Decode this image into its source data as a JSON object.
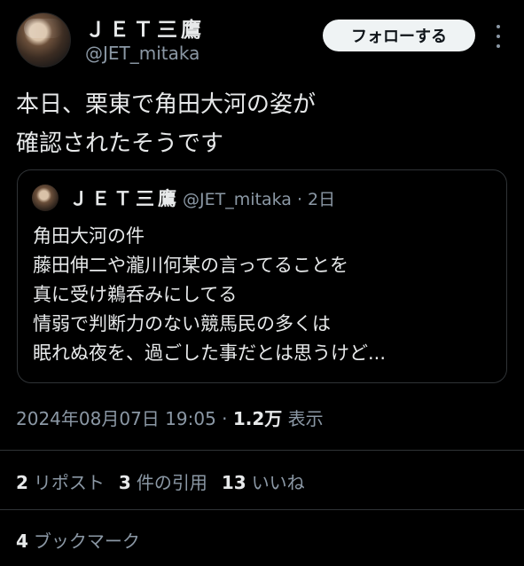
{
  "author": {
    "display_name": "ＪＥＴ三鷹",
    "handle": "@JET_mitaka"
  },
  "follow_button": "フォローする",
  "tweet": {
    "lines": [
      "本日、栗東で角田大河の姿が",
      "確認されたそうです"
    ]
  },
  "quoted": {
    "display_name": "ＪＥＴ三鷹",
    "meta": "@JET_mitaka · 2日",
    "lines": [
      "角田大河の件",
      "藤田伸二や瀧川何某の言ってることを",
      "真に受け鵜呑みにしてる",
      "情弱で判断力のない競馬民の多くは",
      "眠れぬ夜を、過ごした事だとは思うけど..."
    ]
  },
  "timestamp": "2024年08月07日 19:05 · ",
  "views": {
    "count": "1.2万",
    "label": " 表示"
  },
  "stats": {
    "reposts": {
      "count": "2",
      "label": "リポスト"
    },
    "quotes": {
      "count": "3",
      "label": "件の引用"
    },
    "likes": {
      "count": "13",
      "label": "いいね"
    },
    "bookmarks": {
      "count": "4",
      "label": "ブックマーク"
    }
  },
  "icons": [
    "more-icon"
  ]
}
